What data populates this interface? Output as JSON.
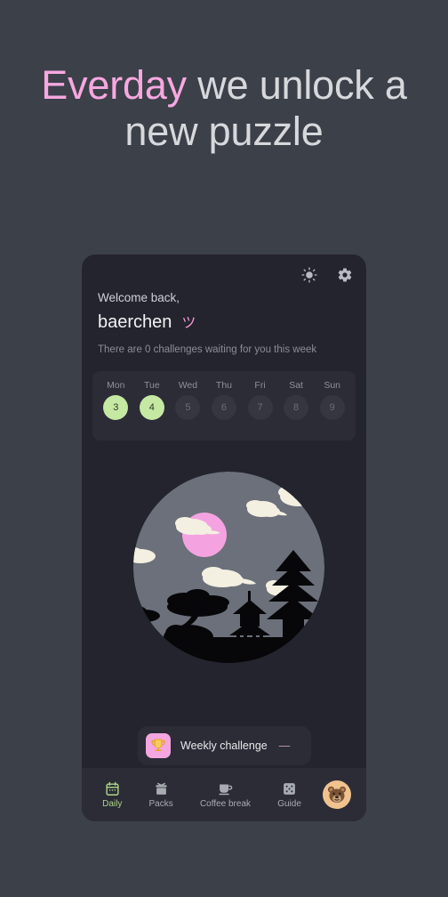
{
  "headline": {
    "accent_word": "Everday",
    "rest": " we unlock a new puzzle",
    "accent_color": "#f7a8e0",
    "text_color": "#d6d8dc"
  },
  "card": {
    "top_icons": [
      {
        "name": "brightness-icon",
        "label": "Brightness"
      },
      {
        "name": "settings-icon",
        "label": "Settings"
      }
    ],
    "greeting": {
      "welcome": "Welcome back,",
      "username": "baerchen",
      "kaomoji": "ツ",
      "subtitle": "There are 0 challenges waiting for you this week"
    },
    "week": {
      "labels": [
        "Mon",
        "Tue",
        "Wed",
        "Thu",
        "Fri",
        "Sat",
        "Sun"
      ],
      "dates": [
        "3",
        "4",
        "5",
        "6",
        "7",
        "8",
        "9"
      ],
      "active": [
        true,
        true,
        false,
        false,
        false,
        false,
        false
      ],
      "active_color": "#c5e8a2",
      "inactive_color": "#35363f"
    },
    "illustration": {
      "name": "japanese-night-scene",
      "circle_color": "#6b707a",
      "moon_color": "#f4a3e0",
      "cloud_color": "#f3f0e2",
      "silhouette_color": "#07070a"
    },
    "challenge": {
      "icon": "trophy-icon",
      "label": "Weekly challenge",
      "dash": "—",
      "tile_color": "#f3a6df"
    },
    "nav": {
      "items": [
        {
          "label": "Daily",
          "icon": "calendar-icon",
          "active": true
        },
        {
          "label": "Packs",
          "icon": "gift-box-icon",
          "active": false
        },
        {
          "label": "Coffee break",
          "icon": "coffee-cup-icon",
          "active": false
        },
        {
          "label": "Guide",
          "icon": "dice-icon",
          "active": false
        }
      ],
      "avatar": {
        "name": "bear-avatar",
        "bg": "#f0c38e"
      },
      "active_color": "#aed585"
    }
  }
}
